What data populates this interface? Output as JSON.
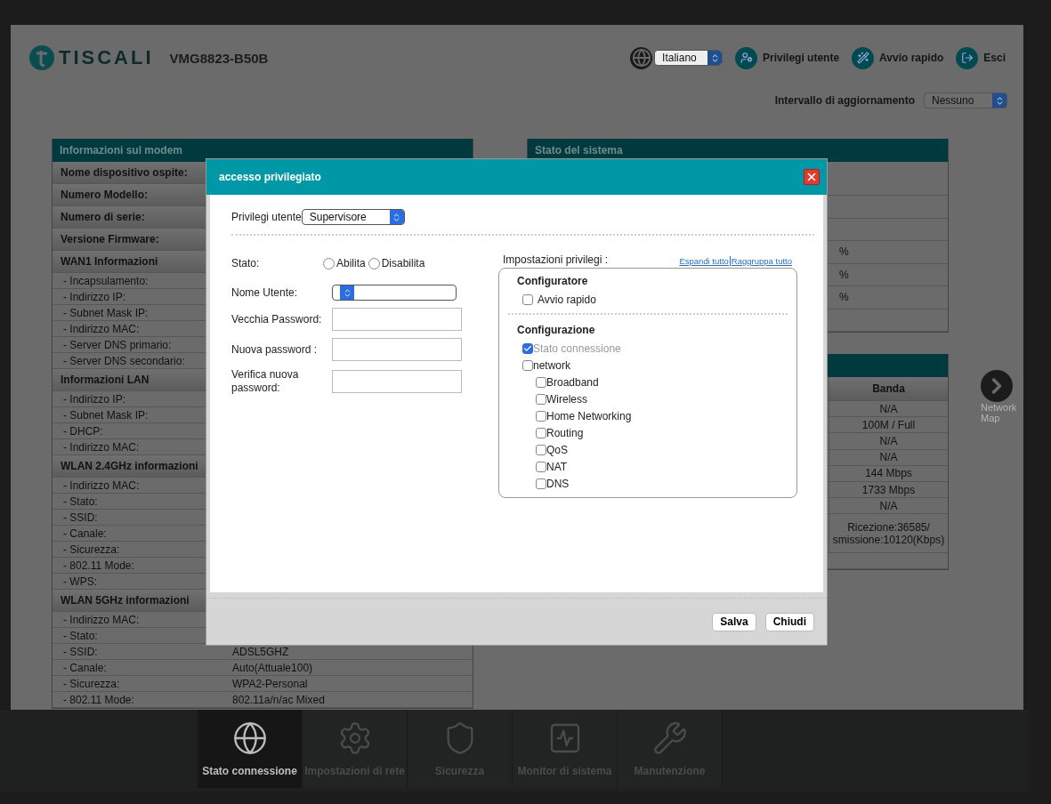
{
  "header": {
    "logo": "TISCALI",
    "model": "VMG8823-B50B",
    "language": "Italiano",
    "actions": [
      {
        "label": "Privilegi utente"
      },
      {
        "label": "Avvio rapido"
      },
      {
        "label": "Esci"
      }
    ],
    "refresh": {
      "label": "Intervallo di aggiornamento",
      "value": "Nessuno"
    }
  },
  "modem_panel": {
    "title": "Informazioni sul modem",
    "rows": [
      {
        "kind": "heading",
        "label": "Nome dispositivo ospite:"
      },
      {
        "kind": "heading",
        "label": "Numero Modello:"
      },
      {
        "kind": "heading",
        "label": "Numero di serie:"
      },
      {
        "kind": "heading",
        "label": "Versione Firmware:"
      },
      {
        "kind": "heading",
        "label": "WAN1 Informazioni"
      },
      {
        "kind": "item",
        "label": "- Incapsulamento:"
      },
      {
        "kind": "item",
        "label": "- Indirizzo IP:"
      },
      {
        "kind": "item",
        "label": "- Subnet Mask IP:"
      },
      {
        "kind": "item",
        "label": "- Indirizzo MAC:"
      },
      {
        "kind": "item",
        "label": "- Server DNS primario:"
      },
      {
        "kind": "item",
        "label": "- Server DNS secondario:"
      },
      {
        "kind": "heading",
        "label": "Informazioni LAN"
      },
      {
        "kind": "item",
        "label": "- Indirizzo IP:"
      },
      {
        "kind": "item",
        "label": "- Subnet Mask IP:"
      },
      {
        "kind": "item",
        "label": "- DHCP:"
      },
      {
        "kind": "item",
        "label": "- Indirizzo MAC:"
      },
      {
        "kind": "heading",
        "label": "WLAN 2.4GHz informazioni"
      },
      {
        "kind": "item",
        "label": "- Indirizzo MAC:"
      },
      {
        "kind": "item",
        "label": "- Stato:"
      },
      {
        "kind": "item",
        "label": "- SSID:"
      },
      {
        "kind": "item",
        "label": "- Canale:"
      },
      {
        "kind": "item",
        "label": "- Sicurezza:"
      },
      {
        "kind": "item",
        "label": "- 802.11 Mode:"
      },
      {
        "kind": "item",
        "label": "- WPS:"
      },
      {
        "kind": "heading",
        "label": "WLAN 5GHz informazioni"
      },
      {
        "kind": "item",
        "label": "- Indirizzo MAC:"
      },
      {
        "kind": "item",
        "label": "- Stato:"
      },
      {
        "kind": "item",
        "label": "- SSID:",
        "value": "ADSL5GHZ"
      },
      {
        "kind": "item",
        "label": "- Canale:",
        "value": "Auto(Attuale100)"
      },
      {
        "kind": "item",
        "label": "- Sicurezza:",
        "value": "WPA2-Personal"
      },
      {
        "kind": "item",
        "label": "- 802.11 Mode:",
        "value": "802.11a/n/ac Mixed"
      }
    ]
  },
  "system_panel": {
    "title": "Stato del sistema",
    "rows": [
      {
        "kind": "blank"
      },
      {
        "kind": "blank"
      },
      {
        "kind": "blank"
      },
      {
        "kind": "value",
        "value": "%"
      },
      {
        "kind": "value",
        "value": "%"
      },
      {
        "kind": "value",
        "value": "%"
      },
      {
        "kind": "blank"
      }
    ]
  },
  "interface_panel": {
    "columns": [
      "Banda"
    ],
    "rows": [
      [
        "N/A"
      ],
      [
        "100M / Full"
      ],
      [
        "N/A"
      ],
      [
        "N/A"
      ],
      [
        "144 Mbps"
      ],
      [
        "1733 Mbps"
      ],
      [
        "N/A"
      ],
      [
        "Ricezione:36585/",
        "smissione:10120(Kbps)"
      ]
    ]
  },
  "network_map": {
    "label": "Network Map"
  },
  "nav": [
    {
      "label": "Stato connessione",
      "selected": true
    },
    {
      "label": "Impostazioni di rete",
      "selected": false
    },
    {
      "label": "Sicurezza",
      "selected": false
    },
    {
      "label": "Monitor di sistema",
      "selected": false
    },
    {
      "label": "Manutenzione",
      "selected": false
    }
  ],
  "dialog": {
    "title": "accesso privilegiato",
    "privilege": {
      "label": "Privilegi utente",
      "value": "Supervisore"
    },
    "fields": [
      {
        "kind": "radio",
        "label": "Stato:",
        "options": [
          {
            "label": "Abilita",
            "selected": false
          },
          {
            "label": "Disabilita",
            "selected": false
          }
        ]
      },
      {
        "kind": "select",
        "label": "Nome Utente:"
      },
      {
        "kind": "input",
        "label": "Vecchia Password:"
      },
      {
        "kind": "input",
        "label": "Nuova password :"
      },
      {
        "kind": "input",
        "label": "Verifica nuova password:"
      }
    ],
    "settings": {
      "label": "Impostazioni privilegi :",
      "links": [
        "Espandi tutto",
        "Raggruppa tutto"
      ],
      "groups": [
        {
          "title": "Configuratore",
          "items": [
            {
              "label": "Avvio rapido",
              "checked": false,
              "disabled": false
            }
          ]
        },
        {
          "title": "Configurazione",
          "items": [
            {
              "label": "Stato connessione",
              "checked": true,
              "disabled": true
            },
            {
              "label": "network",
              "checked": false,
              "disabled": false,
              "children": [
                {
                  "label": "Broadband",
                  "checked": false,
                  "disabled": false
                },
                {
                  "label": "Wireless",
                  "checked": false,
                  "disabled": false
                },
                {
                  "label": "Home Networking",
                  "checked": false,
                  "disabled": false
                },
                {
                  "label": "Routing",
                  "checked": false,
                  "disabled": false
                },
                {
                  "label": "QoS",
                  "checked": false,
                  "disabled": false
                },
                {
                  "label": "NAT",
                  "checked": false,
                  "disabled": false
                },
                {
                  "label": "DNS",
                  "checked": false,
                  "disabled": false
                }
              ]
            }
          ]
        }
      ]
    },
    "buttons": [
      "Salva",
      "Chiudi"
    ]
  }
}
